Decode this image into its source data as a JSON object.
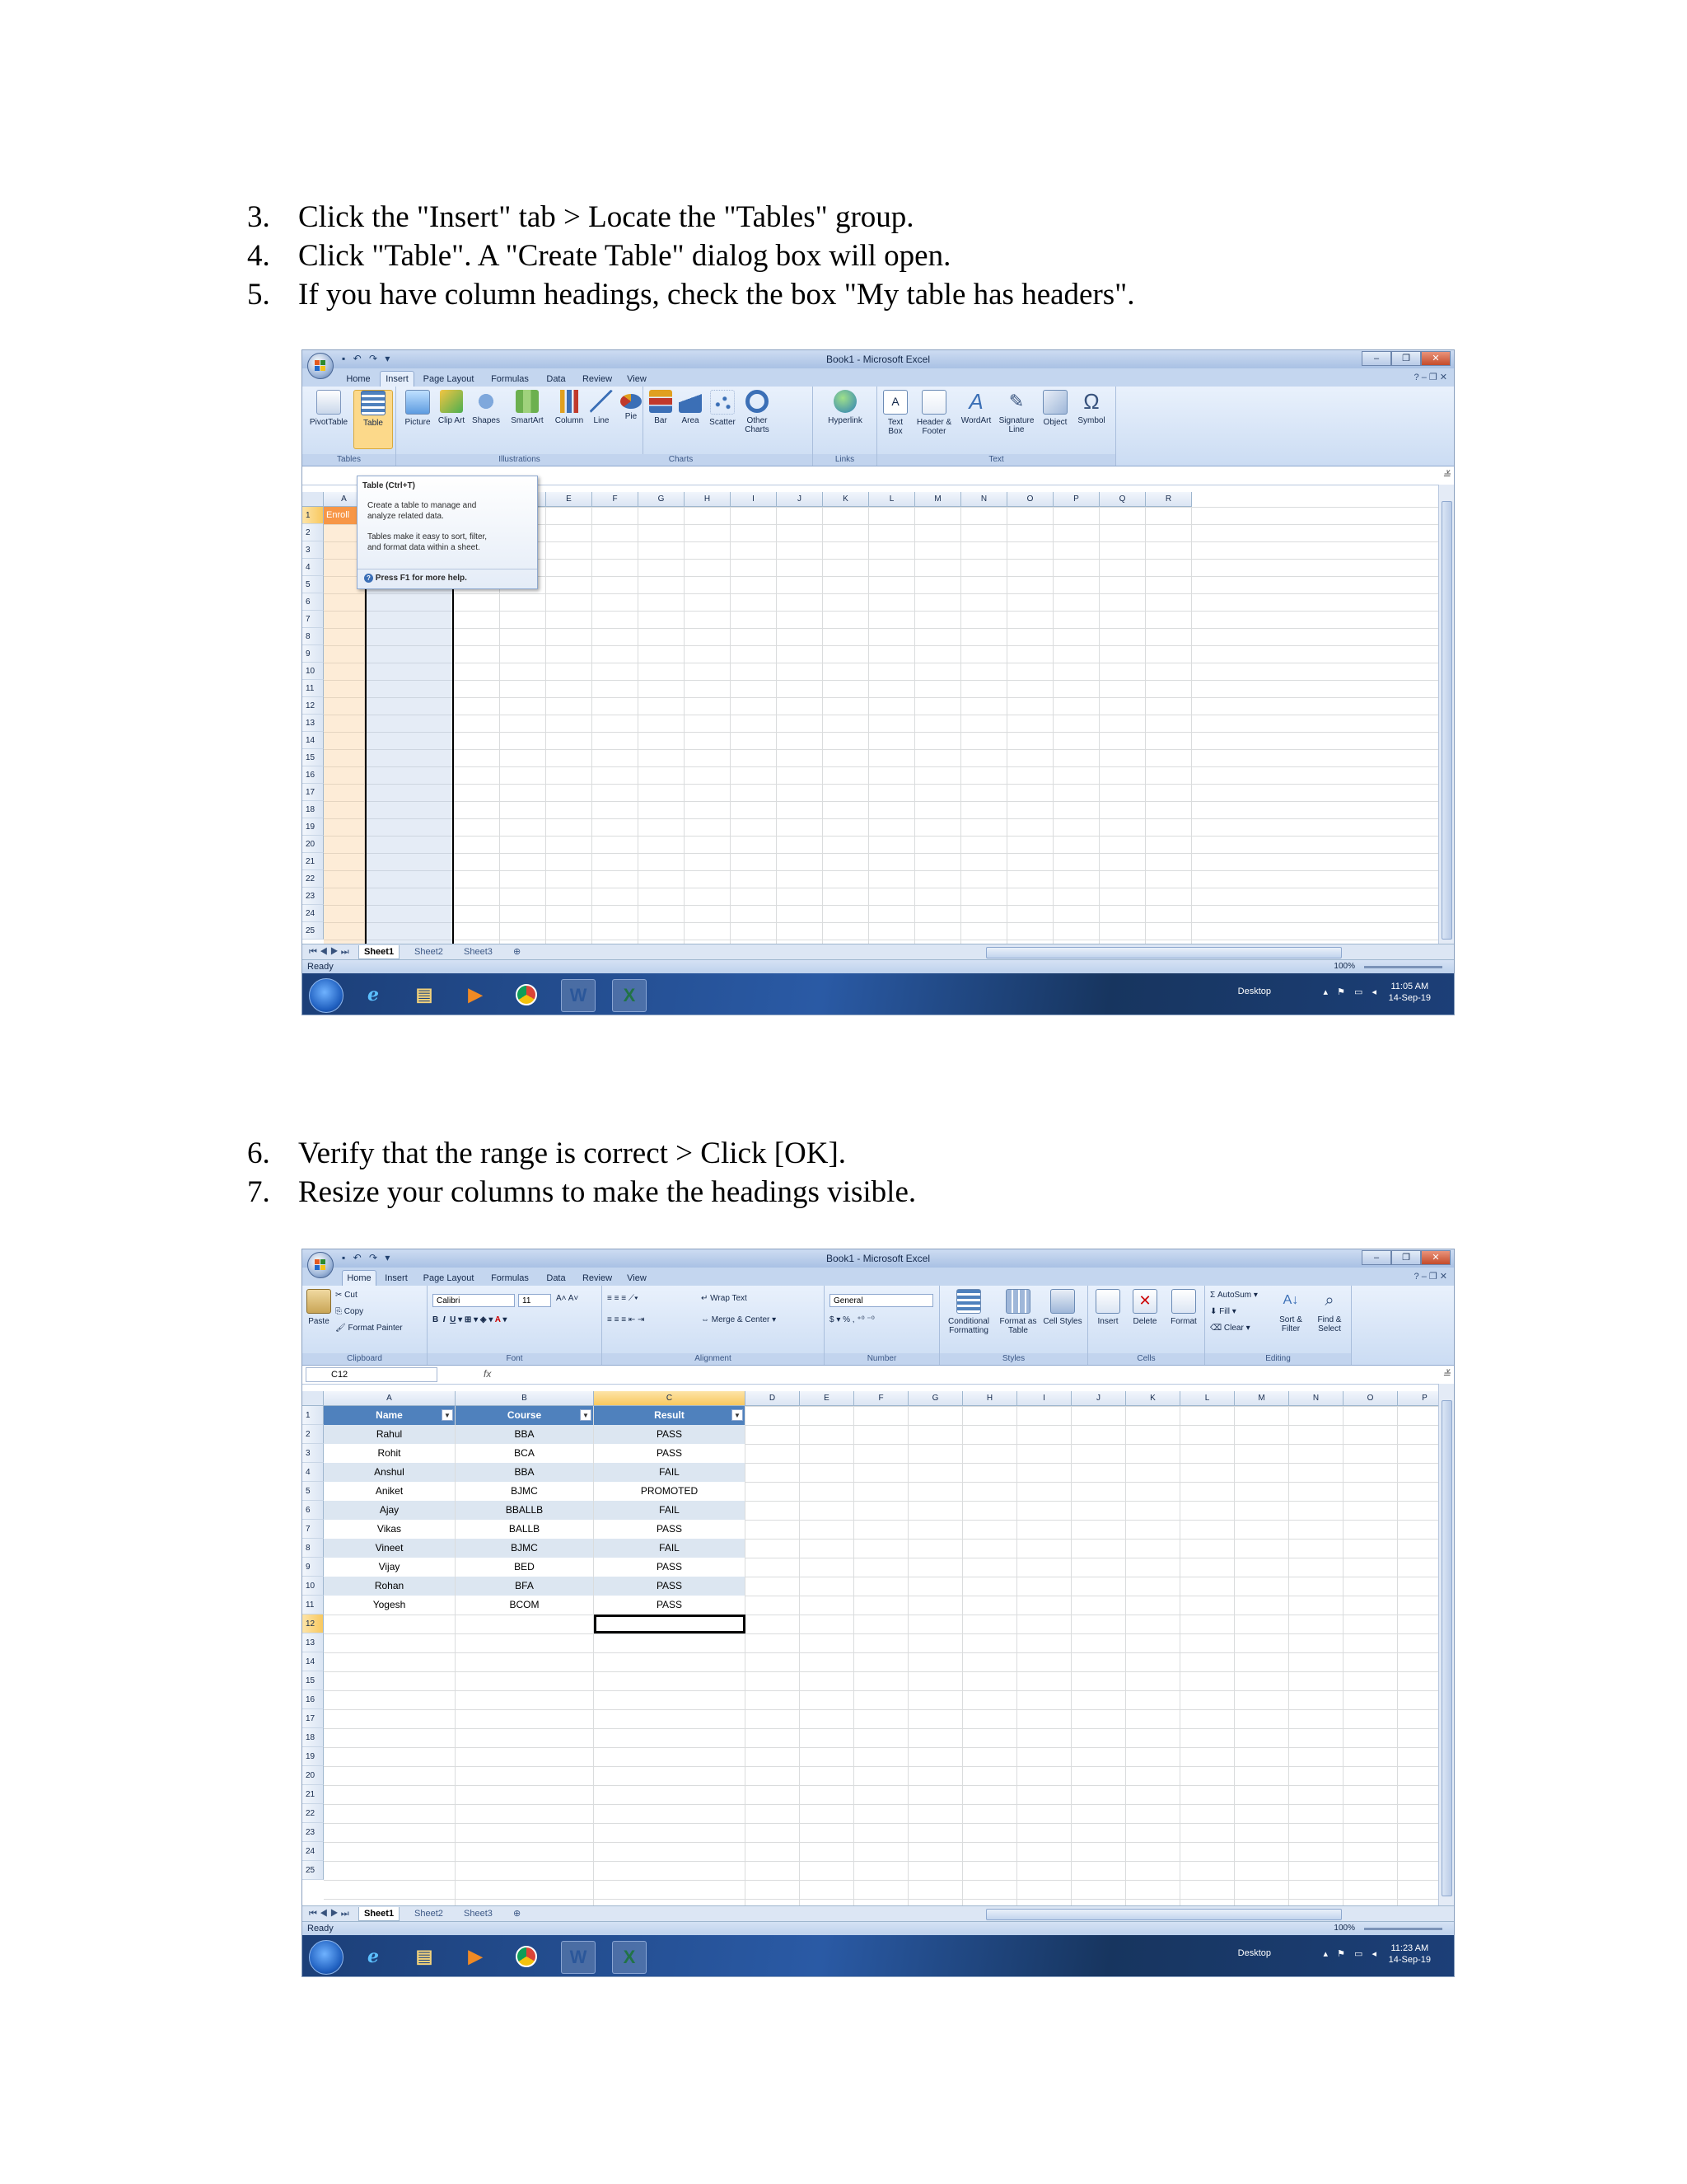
{
  "steps_top": [
    {
      "num": "3.",
      "text": "Click the \"Insert\" tab > Locate the \"Tables\" group."
    },
    {
      "num": "4.",
      "text": "Click \"Table\". A \"Create Table\" dialog box will open."
    },
    {
      "num": "5.",
      "text": "If you have column headings, check the box \"My table has headers\"."
    }
  ],
  "steps_bottom": [
    {
      "num": "6.",
      "text": "Verify that the range is correct > Click [OK]."
    },
    {
      "num": "7.",
      "text": "Resize your columns to make the headings visible."
    }
  ],
  "window": {
    "title": "Book1 - Microsoft Excel",
    "tabs": [
      "Home",
      "Insert",
      "Page Layout",
      "Formulas",
      "Data",
      "Review",
      "View"
    ],
    "sheets": [
      "Sheet1",
      "Sheet2",
      "Sheet3"
    ],
    "status": "Ready",
    "zoom": "100%",
    "desktop": "Desktop",
    "columns": [
      "A",
      "B",
      "C",
      "D",
      "E",
      "F",
      "G",
      "H",
      "I",
      "J",
      "K",
      "L",
      "M",
      "N",
      "O",
      "P",
      "Q",
      "R"
    ],
    "rows": [
      "1",
      "2",
      "3",
      "4",
      "5",
      "6",
      "7",
      "8",
      "9",
      "10",
      "11",
      "12",
      "13",
      "14",
      "15",
      "16",
      "17",
      "18",
      "19",
      "20",
      "21",
      "22",
      "23",
      "24",
      "25"
    ]
  },
  "shot1": {
    "active_tab": "Insert",
    "groups": {
      "tables": "Tables",
      "illustrations": "Illustrations",
      "charts": "Charts",
      "links": "Links",
      "text": "Text"
    },
    "buttons": [
      "PivotTable",
      "Table",
      "Picture",
      "Clip Art",
      "Shapes",
      "SmartArt",
      "Column",
      "Line",
      "Pie",
      "Bar",
      "Area",
      "Scatter",
      "Other Charts",
      "Hyperlink",
      "Text Box",
      "Header & Footer",
      "WordArt",
      "Signature Line",
      "Object",
      "Symbol"
    ],
    "tooltip": {
      "title": "Table (Ctrl+T)",
      "line1": "Create a table to manage and",
      "line2": "analyze related data.",
      "line3": "Tables make it easy to sort, filter,",
      "line4": "and format data within a sheet.",
      "help": "Press F1 for more help."
    },
    "a1_text": "Enroll",
    "time": "11:05 AM",
    "date": "14-Sep-19"
  },
  "shot2": {
    "active_tab": "Home",
    "groups": {
      "clipboard": "Clipboard",
      "font": "Font",
      "alignment": "Alignment",
      "number": "Number",
      "styles": "Styles",
      "cells": "Cells",
      "editing": "Editing"
    },
    "clipboard": {
      "paste": "Paste",
      "cut": "Cut",
      "copy": "Copy",
      "format_painter": "Format Painter"
    },
    "font": {
      "name": "Calibri",
      "size": "11"
    },
    "alignment": {
      "wrap": "Wrap Text",
      "merge": "Merge & Center"
    },
    "number": {
      "format": "General"
    },
    "styles": {
      "conditional": "Conditional Formatting",
      "format_table": "Format as Table",
      "cell_styles": "Cell Styles"
    },
    "cells": {
      "insert": "Insert",
      "delete": "Delete",
      "format": "Format"
    },
    "editing": {
      "autosum": "AutoSum",
      "fill": "Fill",
      "clear": "Clear",
      "sort": "Sort & Filter",
      "find": "Find & Select"
    },
    "name_box": "C12",
    "table": {
      "headers": [
        "Name",
        "Course",
        "Result"
      ],
      "rows": [
        [
          "Rahul",
          "BBA",
          "PASS"
        ],
        [
          "Rohit",
          "BCA",
          "PASS"
        ],
        [
          "Anshul",
          "BBA",
          "FAIL"
        ],
        [
          "Aniket",
          "BJMC",
          "PROMOTED"
        ],
        [
          "Ajay",
          "BBALLB",
          "FAIL"
        ],
        [
          "Vikas",
          "BALLB",
          "PASS"
        ],
        [
          "Vineet",
          "BJMC",
          "FAIL"
        ],
        [
          "Vijay",
          "BED",
          "PASS"
        ],
        [
          "Rohan",
          "BFA",
          "PASS"
        ],
        [
          "Yogesh",
          "BCOM",
          "PASS"
        ]
      ]
    },
    "time": "11:23 AM",
    "date": "14-Sep-19"
  },
  "colors": {
    "table_header": "#4f81bd",
    "band": "#dce6f1",
    "selection": "#f8c85f"
  }
}
